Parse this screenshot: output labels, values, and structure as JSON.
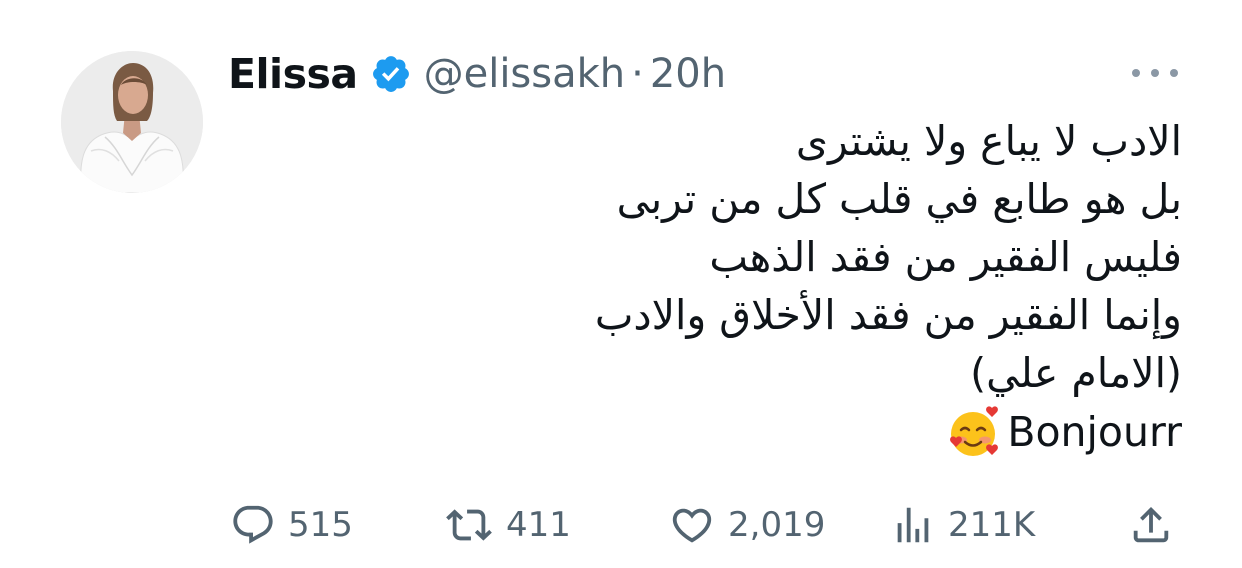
{
  "tweet": {
    "display_name": "Elissa",
    "handle": "@elissakh",
    "separator": "·",
    "time": "20h",
    "body_lines": [
      "الادب لا يباع ولا يشترى",
      "بل هو طابع في قلب كل من تربى",
      "فليس الفقير من فقد الذهب",
      "وإنما الفقير من فقد الأخلاق والادب",
      "(الامام علي)"
    ],
    "last_line_text": "Bonjourr",
    "last_line_emoji": "smiling-face-with-hearts-icon"
  },
  "actions": {
    "replies": "515",
    "retweets": "411",
    "likes": "2,019",
    "views": "211K"
  },
  "colors": {
    "verified": "#1d9bf0",
    "muted": "#536471",
    "text": "#0f1419"
  }
}
